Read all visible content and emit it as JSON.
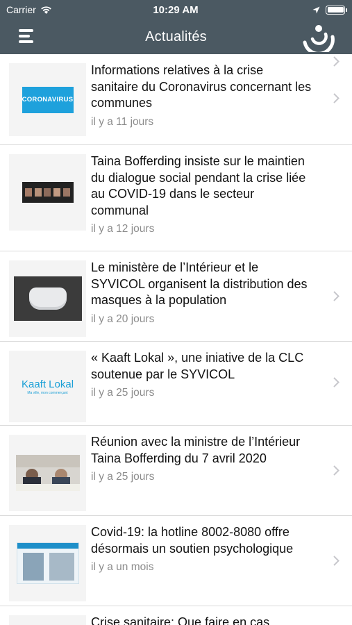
{
  "status_bar": {
    "carrier": "Carrier",
    "time": "10:29 AM"
  },
  "nav": {
    "title": "Actualités",
    "menu_icon": "hamburger-menu-icon",
    "logo_icon": "syvicol-logo-icon"
  },
  "colors": {
    "nav_bg": "#4b5962",
    "corona_banner_bg": "#1ea1dc",
    "kaaft_text": "#1a9fd6"
  },
  "news": [
    {
      "title": "Informations relatives à la crise sanitaire du Coronavirus concernant les communes",
      "date": "il y a 11 jours",
      "thumb_text": "CORONAVIRUS"
    },
    {
      "title": "Taina Bofferding insiste sur le maintien du dialogue social pendant la crise liée au COVID-19 dans le secteur communal",
      "date": "il y a 12 jours"
    },
    {
      "title": "Le ministère de l’Intérieur et le SYVICOL organisent la distribution des masques à la population",
      "date": "il y a 20 jours"
    },
    {
      "title": "« Kaaft Lokal », une iniative de la CLC soutenue par le SYVICOL",
      "date": "il y a 25 jours",
      "thumb_text": "Kaaft Lokal",
      "thumb_subtext": "Ma ville, mon commerçant"
    },
    {
      "title": "Réunion avec la ministre de l’Intérieur Taina Bofferding du 7 avril 2020",
      "date": "il y a 25 jours"
    },
    {
      "title": "Covid-19: la hotline 8002-8080 offre désormais un soutien psychologique",
      "date": "il y a un mois"
    },
    {
      "title": "Crise sanitaire: Que faire en cas",
      "date": ""
    }
  ]
}
